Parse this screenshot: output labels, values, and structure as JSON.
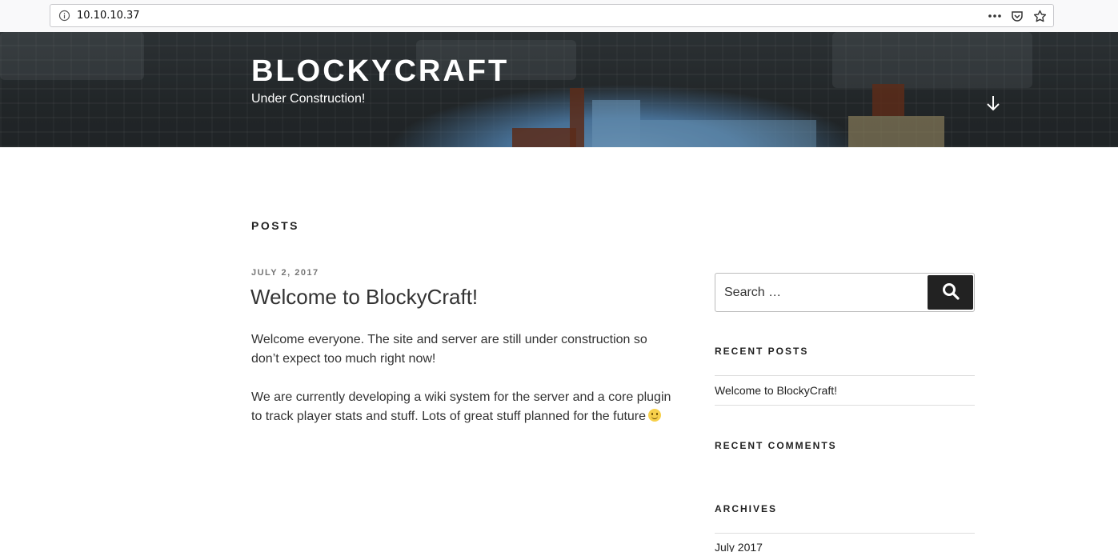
{
  "browser": {
    "url": "10.10.10.37"
  },
  "header": {
    "site_title": "BLOCKYCRAFT",
    "site_description": "Under Construction!"
  },
  "main": {
    "page_title": "POSTS",
    "post": {
      "date": "JULY 2, 2017",
      "title": "Welcome to BlockyCraft!",
      "paragraphs": [
        "Welcome everyone. The site and server are still under construction so don’t expect too much right now!",
        "We are currently developing a wiki system for the server and a core plugin to track player stats and stuff. Lots of great stuff planned for the future"
      ]
    }
  },
  "sidebar": {
    "search": {
      "placeholder": "Search …"
    },
    "recent_posts": {
      "title": "RECENT POSTS",
      "items": [
        "Welcome to BlockyCraft!"
      ]
    },
    "recent_comments": {
      "title": "RECENT COMMENTS"
    },
    "archives": {
      "title": "ARCHIVES",
      "items": [
        "July 2017"
      ]
    }
  }
}
